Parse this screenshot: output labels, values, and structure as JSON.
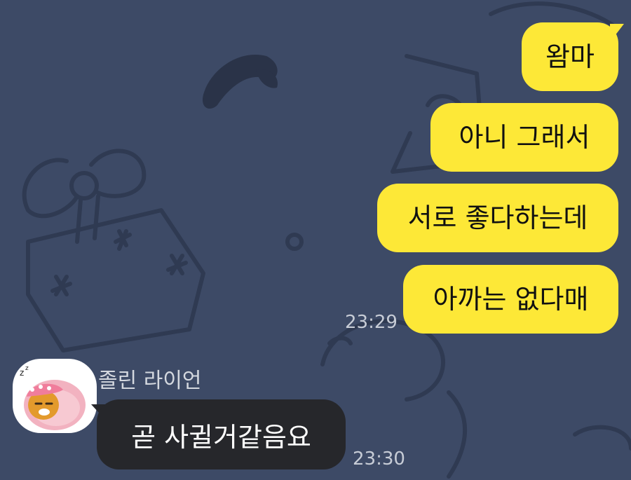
{
  "chat": {
    "outgoing": [
      {
        "text": "왐마"
      },
      {
        "text": "아니 그래서"
      },
      {
        "text": "서로 좋다하는데"
      },
      {
        "text": "아까는 없다매"
      }
    ],
    "outgoing_time": "23:29",
    "incoming": {
      "sender": "졸린 라이언",
      "text": "곧 사귈거같음요",
      "time": "23:30",
      "avatar_icon": "sleeping-ryan-avatar-icon"
    }
  },
  "colors": {
    "background": "#3d4a66",
    "outgoing_bubble": "#fde837",
    "incoming_bubble": "#26272b"
  }
}
